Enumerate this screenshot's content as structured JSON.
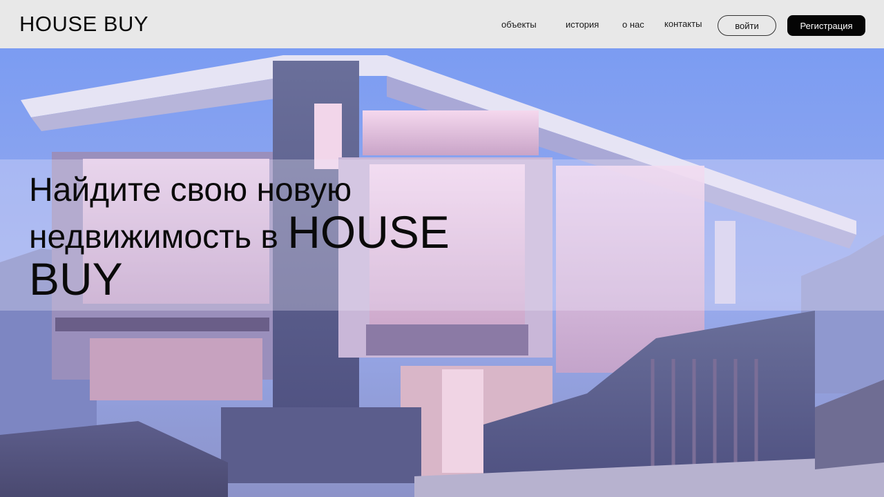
{
  "header": {
    "logo": "HOUSE BUY",
    "nav": {
      "objects": "объекты",
      "history": "история",
      "about": "о нас",
      "contacts": "контакты"
    },
    "login": "войти",
    "register": "Регистрация"
  },
  "hero": {
    "headline_part1": "Найдите свою новую",
    "headline_part2": "недвижимость в",
    "headline_brand_a": "HOUSE",
    "headline_brand_b": "BUY"
  },
  "colors": {
    "header_bg": "#e8e8e8",
    "register_bg": "#050505",
    "sky": "#7f9ff0"
  }
}
